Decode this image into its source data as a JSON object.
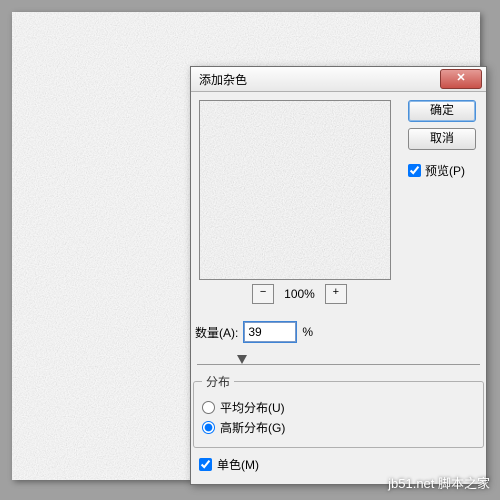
{
  "dialog": {
    "title": "添加杂色",
    "ok_label": "确定",
    "cancel_label": "取消",
    "preview_checkbox_label": "预览(P)",
    "preview_checked": true,
    "zoom_level": "100%",
    "amount_label": "数量(A):",
    "amount_value": "39",
    "amount_unit": "%",
    "distribution_legend": "分布",
    "uniform_label": "平均分布(U)",
    "gaussian_label": "高斯分布(G)",
    "distribution_selected": "gaussian",
    "mono_label": "单色(M)",
    "mono_checked": true
  },
  "watermark": "jb51.net 脚本之家"
}
